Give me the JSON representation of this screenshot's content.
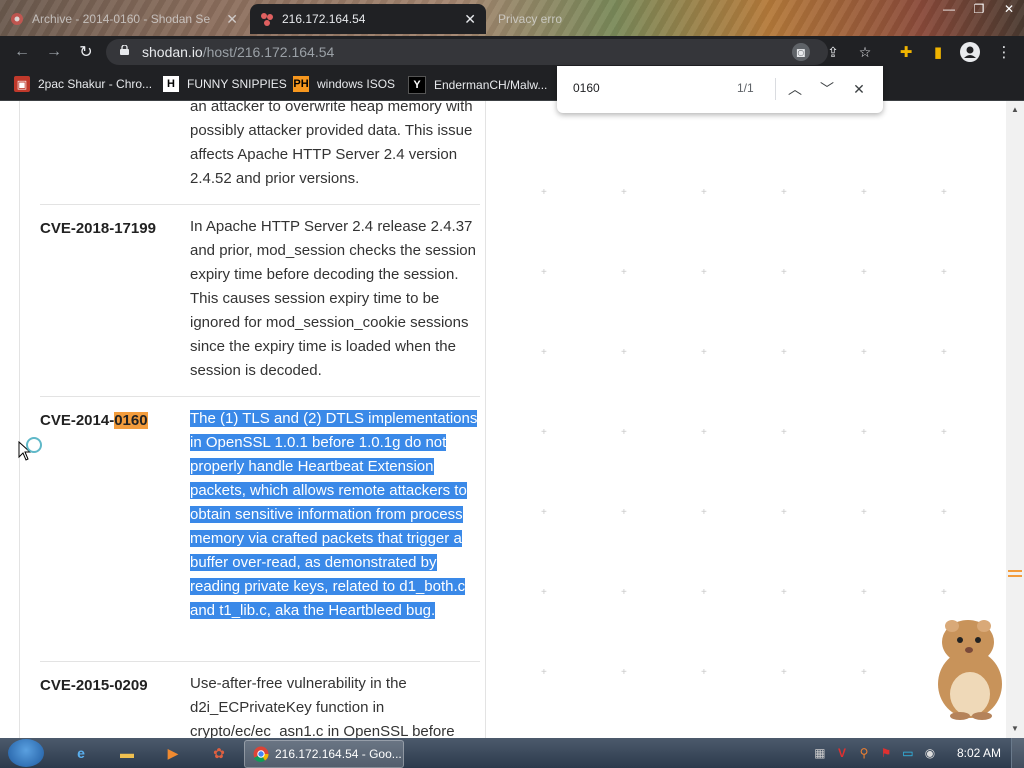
{
  "browser": {
    "tabs": [
      {
        "title": "Archive - 2014-0160 - Shodan Se",
        "active": false
      },
      {
        "title": "216.172.164.54",
        "active": true
      },
      {
        "title": "Privacy erro",
        "active": false
      }
    ],
    "url_host": "shodan.io",
    "url_path": "/host/216.172.164.54",
    "bookmarks": [
      {
        "label": "2pac Shakur - Chro...",
        "icon": "bookmark-icon"
      },
      {
        "label": "FUNNY SNIPPIES",
        "icon_text": "H"
      },
      {
        "label": "windows ISOS",
        "icon_text": "PH"
      },
      {
        "label": "EndermanCH/Malw...",
        "icon_text": "Y"
      }
    ]
  },
  "find": {
    "query": "0160",
    "count": "1/1"
  },
  "vulns": [
    {
      "id": "",
      "desc": "an attacker to overwrite heap memory with possibly attacker provided data. This issue affects Apache HTTP Server 2.4 version 2.4.52 and prior versions."
    },
    {
      "id": "CVE-2018-17199",
      "desc": "In Apache HTTP Server 2.4 release 2.4.37 and prior, mod_session checks the session expiry time before decoding the session. This causes session expiry time to be ignored for mod_session_cookie sessions since the expiry time is loaded when the session is decoded."
    },
    {
      "id_prefix": "CVE-2014-",
      "id_match": "0160",
      "desc": "The (1) TLS and (2) DTLS implementations in OpenSSL 1.0.1 before 1.0.1g do not properly handle Heartbeat Extension packets, which allows remote attackers to obtain sensitive information from process memory via crafted packets that trigger a buffer over-read, as demonstrated by reading private keys, related to d1_both.c and t1_lib.c, aka the Heartbleed bug."
    },
    {
      "id": "CVE-2015-0209",
      "desc": "Use-after-free vulnerability in the d2i_ECPrivateKey function in crypto/ec/ec_asn1.c in OpenSSL before"
    }
  ],
  "taskbar": {
    "task_title": "216.172.164.54 - Goo...",
    "clock": "8:02 AM"
  },
  "colors": {
    "match_highlight": "#f39c3c",
    "selection": "#3a89e8",
    "chrome_dark": "#202124"
  }
}
